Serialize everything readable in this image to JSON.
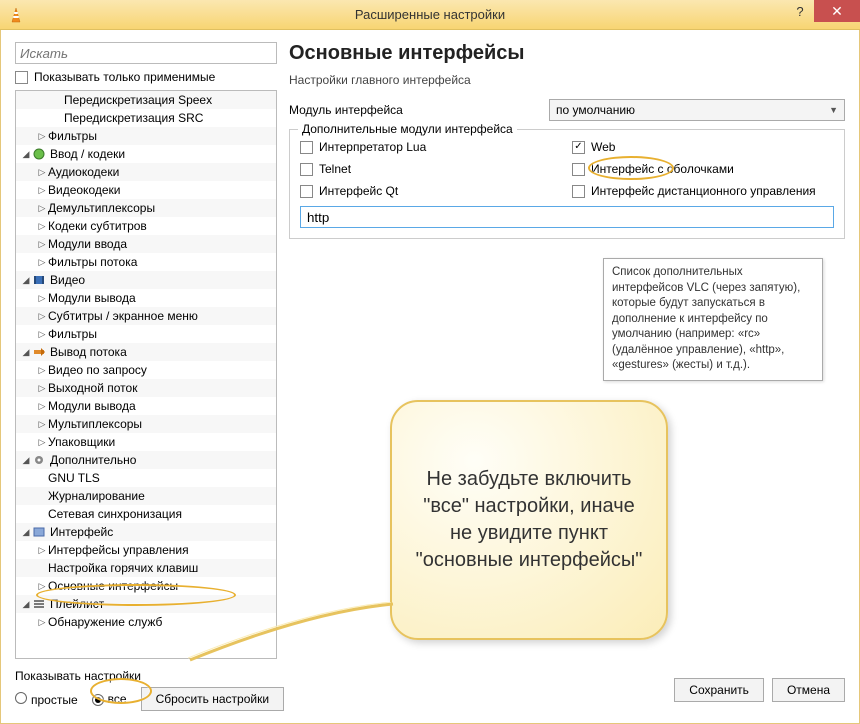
{
  "window": {
    "title": "Расширенные настройки",
    "help_symbol": "?",
    "close_symbol": "✕"
  },
  "search": {
    "placeholder": "Искать"
  },
  "only_applicable": {
    "label": "Показывать только применимые",
    "checked": false
  },
  "tree": [
    {
      "label": "Передискретизация Speex",
      "level": 2,
      "disclosure": ""
    },
    {
      "label": "Передискретизация SRC",
      "level": 2,
      "disclosure": ""
    },
    {
      "label": "Фильтры",
      "level": 1,
      "disclosure": "collapsed"
    },
    {
      "label": "Ввод / кодеки",
      "level": 0,
      "disclosure": "expanded",
      "icon": "disc"
    },
    {
      "label": "Аудиокодеки",
      "level": 1,
      "disclosure": "collapsed"
    },
    {
      "label": "Видеокодеки",
      "level": 1,
      "disclosure": "collapsed"
    },
    {
      "label": "Демультиплексоры",
      "level": 1,
      "disclosure": "collapsed"
    },
    {
      "label": "Кодеки субтитров",
      "level": 1,
      "disclosure": "collapsed"
    },
    {
      "label": "Модули ввода",
      "level": 1,
      "disclosure": "collapsed"
    },
    {
      "label": "Фильтры потока",
      "level": 1,
      "disclosure": "collapsed"
    },
    {
      "label": "Видео",
      "level": 0,
      "disclosure": "expanded",
      "icon": "film"
    },
    {
      "label": "Модули вывода",
      "level": 1,
      "disclosure": "collapsed"
    },
    {
      "label": "Субтитры / экранное меню",
      "level": 1,
      "disclosure": "collapsed"
    },
    {
      "label": "Фильтры",
      "level": 1,
      "disclosure": "collapsed"
    },
    {
      "label": "Вывод потока",
      "level": 0,
      "disclosure": "expanded",
      "icon": "stream"
    },
    {
      "label": "Видео по запросу",
      "level": 1,
      "disclosure": "collapsed"
    },
    {
      "label": "Выходной поток",
      "level": 1,
      "disclosure": "collapsed"
    },
    {
      "label": "Модули вывода",
      "level": 1,
      "disclosure": "collapsed"
    },
    {
      "label": "Мультиплексоры",
      "level": 1,
      "disclosure": "collapsed"
    },
    {
      "label": "Упаковщики",
      "level": 1,
      "disclosure": "collapsed"
    },
    {
      "label": "Дополнительно",
      "level": 0,
      "disclosure": "expanded",
      "icon": "gear"
    },
    {
      "label": "GNU TLS",
      "level": 1,
      "disclosure": ""
    },
    {
      "label": "Журналирование",
      "level": 1,
      "disclosure": ""
    },
    {
      "label": "Сетевая синхронизация",
      "level": 1,
      "disclosure": ""
    },
    {
      "label": "Интерфейс",
      "level": 0,
      "disclosure": "expanded",
      "icon": "panel"
    },
    {
      "label": "Интерфейсы управления",
      "level": 1,
      "disclosure": "collapsed"
    },
    {
      "label": "Настройка горячих клавиш",
      "level": 1,
      "disclosure": ""
    },
    {
      "label": "Основные интерфейсы",
      "level": 1,
      "disclosure": "collapsed"
    },
    {
      "label": "Плейлист",
      "level": 0,
      "disclosure": "expanded",
      "icon": "list"
    },
    {
      "label": "Обнаружение служб",
      "level": 1,
      "disclosure": "collapsed"
    }
  ],
  "right": {
    "title": "Основные интерфейсы",
    "subtitle": "Настройки главного интерфейса",
    "module_label": "Модуль интерфейса",
    "module_value": "по умолчанию",
    "fieldset_legend": "Дополнительные модули интерфейса",
    "checks": {
      "lua": {
        "label": "Интерпретатор Lua",
        "checked": false
      },
      "web": {
        "label": "Web",
        "checked": true
      },
      "telnet": {
        "label": "Telnet",
        "checked": false
      },
      "skins": {
        "label": "Интерфейс с оболочками",
        "checked": false
      },
      "qt": {
        "label": "Интерфейс Qt",
        "checked": false
      },
      "remote": {
        "label": "Интерфейс дистанционного управления",
        "checked": false
      }
    },
    "http_value": "http",
    "tooltip": "Список дополнительных интерфейсов VLC (через запятую), которые будут запускаться в дополнение к интерфейсу по умолчанию (например: «rc» (удалённое управление), «http», «gestures» (жесты) и т.д.)."
  },
  "callout": "Не забудьте включить \"все\" настройки, иначе не увидите пункт \"основные интерфейсы\"",
  "footer": {
    "show_settings_label": "Показывать настройки",
    "simple_label": "простые",
    "all_label": "все",
    "reset_label": "Сбросить настройки",
    "save_label": "Сохранить",
    "cancel_label": "Отмена"
  }
}
